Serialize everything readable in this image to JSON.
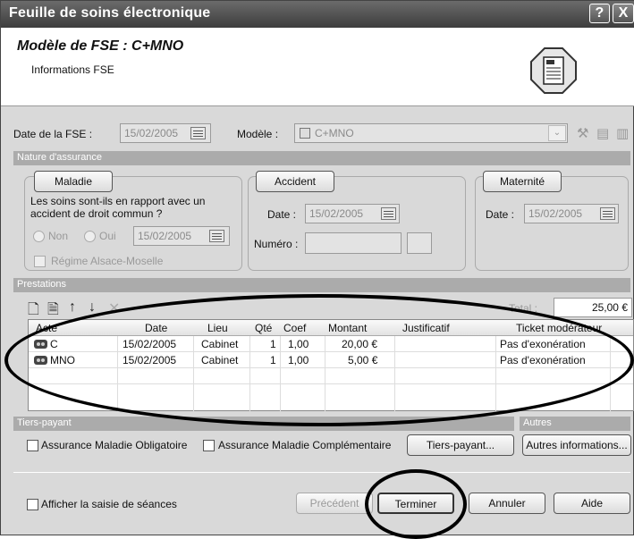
{
  "window": {
    "title": "Feuille de soins électronique",
    "help_label": "?",
    "close_label": "X"
  },
  "header": {
    "title": "Modèle de FSE : C+MNO",
    "subtitle": "Informations FSE",
    "icon": "fse-document-icon"
  },
  "fse": {
    "date_label": "Date de la FSE :",
    "date_value": "15/02/2005",
    "modele_label": "Modèle :",
    "modele_value": "C+MNO"
  },
  "nature": {
    "section_label": "Nature d'assurance",
    "maladie": {
      "button": "Maladie",
      "question": "Les soins sont-ils en rapport avec un accident de droit commun ?",
      "non_label": "Non",
      "oui_label": "Oui",
      "date_value": "15/02/2005",
      "alsace_label": "Régime Alsace-Moselle"
    },
    "accident": {
      "button": "Accident",
      "date_label": "Date :",
      "date_value": "15/02/2005",
      "numero_label": "Numéro :"
    },
    "maternite": {
      "button": "Maternité",
      "date_label": "Date :",
      "date_value": "15/02/2005"
    }
  },
  "prestations": {
    "section_label": "Prestations",
    "total_label": "Total :",
    "total_value": "25,00 €",
    "columns": [
      "Acte",
      "Date",
      "Lieu",
      "Qté",
      "Coef",
      "Montant",
      "Justificatif",
      "Ticket modérateur"
    ],
    "rows": [
      {
        "acte": "C",
        "date": "15/02/2005",
        "lieu": "Cabinet",
        "qte": "1",
        "coef": "1,00",
        "montant": "20,00 €",
        "justificatif": "",
        "ticket": "Pas d'exonération"
      },
      {
        "acte": "MNO",
        "date": "15/02/2005",
        "lieu": "Cabinet",
        "qte": "1",
        "coef": "1,00",
        "montant": "5,00 €",
        "justificatif": "",
        "ticket": "Pas d'exonération"
      }
    ]
  },
  "tiers": {
    "section_label": "Tiers-payant",
    "amo_label": "Assurance Maladie Obligatoire",
    "amc_label": "Assurance Maladie Complémentaire",
    "button": "Tiers-payant..."
  },
  "autres": {
    "section_label": "Autres",
    "button": "Autres informations..."
  },
  "footer": {
    "seances_label": "Afficher la saisie de séances",
    "precedent": "Précédent",
    "terminer": "Terminer",
    "annuler": "Annuler",
    "aide": "Aide"
  }
}
